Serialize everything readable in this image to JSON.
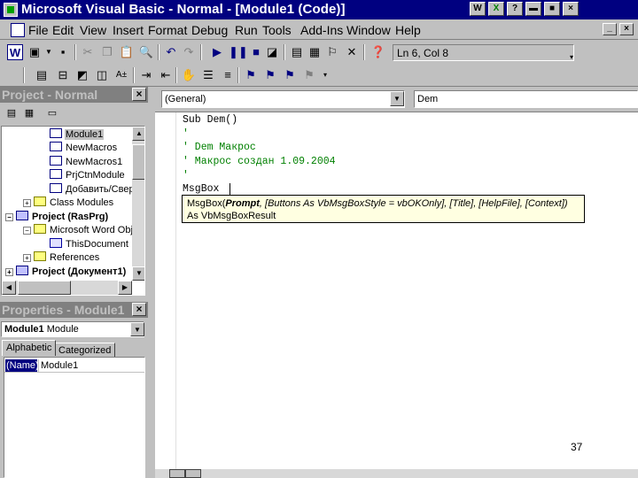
{
  "window": {
    "title": "Microsoft Visual Basic - Normal - [Module1 (Code)]",
    "controls": [
      "_",
      "□",
      "×"
    ],
    "taskbar_icons": [
      "word-icon",
      "excel-icon",
      "help-icon",
      "screen-icon",
      "save-icon",
      "close-icon"
    ]
  },
  "menu": {
    "items": [
      "File",
      "Edit",
      "View",
      "Insert",
      "Format",
      "Debug",
      "Run",
      "Tools",
      "Add-Ins",
      "Window",
      "Help"
    ],
    "right_controls": [
      "_",
      "×"
    ]
  },
  "toolbar": {
    "position_text": "Ln 6, Col 8"
  },
  "project_panel": {
    "title": "Project - Normal",
    "tree": [
      {
        "label": "Module1",
        "selected": true,
        "icon": "module-icon"
      },
      {
        "label": "NewMacros",
        "icon": "module-icon"
      },
      {
        "label": "NewMacros1",
        "icon": "module-icon"
      },
      {
        "label": "PrjCtnModule",
        "icon": "module-icon"
      },
      {
        "label": "Добавить/Сверн",
        "icon": "module-icon"
      },
      {
        "label": "Class Modules",
        "icon": "folder-icon"
      },
      {
        "label": "Project (RasPrg)",
        "icon": "project-icon"
      },
      {
        "label": "Microsoft Word Obj",
        "icon": "folder-icon"
      },
      {
        "label": "ThisDocument",
        "icon": "document-icon"
      },
      {
        "label": "References",
        "icon": "folder-icon"
      },
      {
        "label": "Project (Документ1)",
        "icon": "project-icon"
      }
    ]
  },
  "properties_panel": {
    "title": "Properties - Module1",
    "object_name": "Module1",
    "object_type": "Module",
    "tabs": [
      "Alphabetic",
      "Categorized"
    ],
    "rows": [
      {
        "name": "(Name)",
        "value": "Module1"
      }
    ]
  },
  "code_window": {
    "object_combo": "(General)",
    "proc_combo": "Dem",
    "lines": [
      {
        "text": "Sub Dem()",
        "kind": "code"
      },
      {
        "text": "'",
        "kind": "comment"
      },
      {
        "text": "' Dem Макрос",
        "kind": "comment"
      },
      {
        "text": "' Макрос создан 1.09.2004",
        "kind": "comment"
      },
      {
        "text": "'",
        "kind": "comment"
      },
      {
        "text": "MsgBox ",
        "kind": "code"
      }
    ],
    "tooltip": {
      "prefix": "MsgBox(",
      "bold_param": "Prompt",
      "rest": ", [Buttons As VbMsgBoxStyle = vbOKOnly], [Title], [HelpFile], [Context])",
      "line2": "As VbMsgBoxResult"
    },
    "page_number": "37"
  },
  "colors": {
    "titlebar": "#000080",
    "comment": "#008000",
    "tooltip_bg": "#ffffe1"
  }
}
